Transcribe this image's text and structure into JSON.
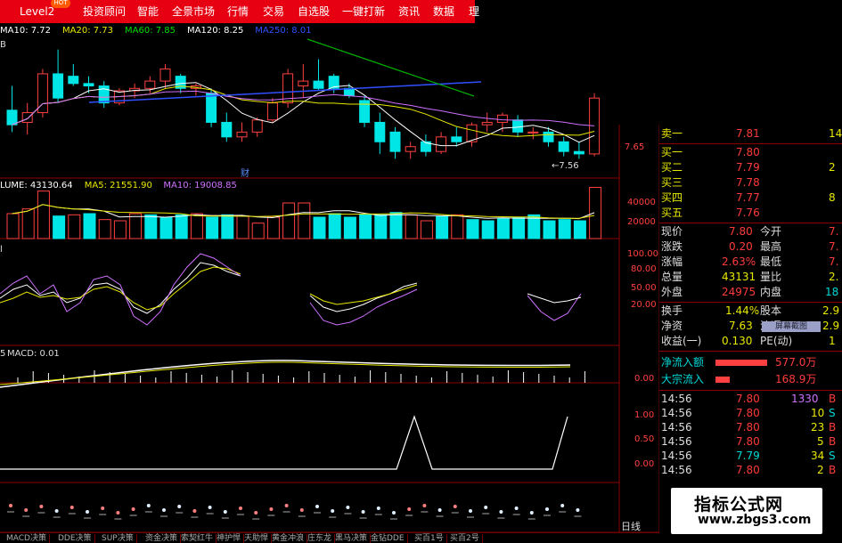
{
  "toolbar": {
    "items": [
      "Level2",
      "投资顾问",
      "智能",
      "全景市场",
      "行情",
      "交易",
      "自选股",
      "一键打新",
      "资讯",
      "数据",
      "理"
    ],
    "hot_badge": "HOT"
  },
  "main_chart": {
    "ma_legend": [
      {
        "text": "MA10: 7.72",
        "color": "#ffffff"
      },
      {
        "text": "MA20: 7.73",
        "color": "#e8e800"
      },
      {
        "text": "MA60: 7.85",
        "color": "#00dd00"
      },
      {
        "text": "MA120: 8.25",
        "color": "#ffffff"
      },
      {
        "text": "MA250: 8.01",
        "color": "#3050ff"
      }
    ],
    "left_fragment": "B",
    "y_label": "7.65",
    "low_marker": "←7.56",
    "cai_badge": "财",
    "candles": [
      {
        "o": 7.75,
        "h": 7.85,
        "l": 7.66,
        "c": 7.69
      },
      {
        "o": 7.7,
        "h": 7.78,
        "l": 7.65,
        "c": 7.74
      },
      {
        "o": 7.74,
        "h": 7.92,
        "l": 7.72,
        "c": 7.9
      },
      {
        "o": 7.9,
        "h": 8.0,
        "l": 7.78,
        "c": 7.8
      },
      {
        "o": 7.89,
        "h": 7.94,
        "l": 7.85,
        "c": 7.86
      },
      {
        "o": 7.86,
        "h": 7.89,
        "l": 7.82,
        "c": 7.85
      },
      {
        "o": 7.85,
        "h": 7.87,
        "l": 7.76,
        "c": 7.78
      },
      {
        "o": 7.78,
        "h": 7.84,
        "l": 7.77,
        "c": 7.83
      },
      {
        "o": 7.83,
        "h": 7.86,
        "l": 7.8,
        "c": 7.84
      },
      {
        "o": 7.84,
        "h": 7.89,
        "l": 7.82,
        "c": 7.87
      },
      {
        "o": 7.87,
        "h": 7.94,
        "l": 7.84,
        "c": 7.92
      },
      {
        "o": 7.89,
        "h": 7.9,
        "l": 7.82,
        "c": 7.84
      },
      {
        "o": 7.84,
        "h": 7.86,
        "l": 7.81,
        "c": 7.85
      },
      {
        "o": 7.82,
        "h": 7.84,
        "l": 7.68,
        "c": 7.7
      },
      {
        "o": 7.7,
        "h": 7.74,
        "l": 7.62,
        "c": 7.64
      },
      {
        "o": 7.64,
        "h": 7.7,
        "l": 7.62,
        "c": 7.66
      },
      {
        "o": 7.66,
        "h": 7.72,
        "l": 7.64,
        "c": 7.71
      },
      {
        "o": 7.71,
        "h": 7.8,
        "l": 7.7,
        "c": 7.78
      },
      {
        "o": 7.78,
        "h": 7.92,
        "l": 7.76,
        "c": 7.9
      },
      {
        "o": 7.85,
        "h": 7.94,
        "l": 7.8,
        "c": 7.87
      },
      {
        "o": 7.87,
        "h": 7.96,
        "l": 7.83,
        "c": 7.84
      },
      {
        "o": 7.89,
        "h": 7.9,
        "l": 7.82,
        "c": 7.84
      },
      {
        "o": 7.84,
        "h": 7.86,
        "l": 7.8,
        "c": 7.81
      },
      {
        "o": 7.79,
        "h": 7.81,
        "l": 7.68,
        "c": 7.7
      },
      {
        "o": 7.7,
        "h": 7.74,
        "l": 7.57,
        "c": 7.62
      },
      {
        "o": 7.66,
        "h": 7.68,
        "l": 7.55,
        "c": 7.58
      },
      {
        "o": 7.58,
        "h": 7.62,
        "l": 7.55,
        "c": 7.6
      },
      {
        "o": 7.62,
        "h": 7.65,
        "l": 7.56,
        "c": 7.58
      },
      {
        "o": 7.58,
        "h": 7.66,
        "l": 7.57,
        "c": 7.64
      },
      {
        "o": 7.64,
        "h": 7.68,
        "l": 7.6,
        "c": 7.62
      },
      {
        "o": 7.62,
        "h": 7.7,
        "l": 7.6,
        "c": 7.69
      },
      {
        "o": 7.69,
        "h": 7.74,
        "l": 7.66,
        "c": 7.7
      },
      {
        "o": 7.7,
        "h": 7.74,
        "l": 7.66,
        "c": 7.73
      },
      {
        "o": 7.71,
        "h": 7.73,
        "l": 7.64,
        "c": 7.66
      },
      {
        "o": 7.66,
        "h": 7.68,
        "l": 7.63,
        "c": 7.66
      },
      {
        "o": 7.66,
        "h": 7.68,
        "l": 7.6,
        "c": 7.62
      },
      {
        "o": 7.62,
        "h": 7.64,
        "l": 7.56,
        "c": 7.58
      },
      {
        "o": 7.58,
        "h": 7.62,
        "l": 7.55,
        "c": 7.57
      },
      {
        "o": 7.57,
        "h": 7.82,
        "l": 7.56,
        "c": 7.8
      }
    ]
  },
  "volume_chart": {
    "legend": [
      {
        "text": "LUME: 43130.64",
        "color": "#ffffff"
      },
      {
        "text": "MA5: 21551.90",
        "color": "#e8e800"
      },
      {
        "text": "MA10: 19008.85",
        "color": "#d070ff"
      }
    ],
    "y_labels": [
      "40000",
      "20000"
    ],
    "values": [
      21000,
      25000,
      40000,
      19000,
      20000,
      21000,
      16000,
      15000,
      21000,
      20000,
      18000,
      20000,
      21000,
      18000,
      20000,
      19000,
      13000,
      18000,
      30000,
      30000,
      18000,
      21000,
      18000,
      20000,
      20000,
      22000,
      20000,
      15000,
      19000,
      20000,
      16000,
      15000,
      17000,
      18000,
      20000,
      15000,
      16000,
      15000,
      43130
    ],
    "up_flags": [
      1,
      1,
      1,
      0,
      1,
      0,
      1,
      1,
      1,
      0,
      0,
      0,
      1,
      0,
      0,
      1,
      1,
      1,
      1,
      1,
      0,
      0,
      0,
      0,
      0,
      0,
      1,
      1,
      0,
      1,
      0,
      0,
      0,
      0,
      0,
      0,
      0,
      0,
      1
    ]
  },
  "kdj_chart": {
    "left_fragment": "l",
    "y_labels": [
      "100.00",
      "80.00",
      "50.00",
      "20.00"
    ]
  },
  "macd_chart": {
    "legend": "MACD: 0.01",
    "left_fragment": "5",
    "y_label": "0.00"
  },
  "signal_chart": {
    "y_labels": [
      "1.00",
      "0.50",
      "0.00"
    ]
  },
  "orderbook": {
    "rows": [
      {
        "label": "卖一",
        "price": "7.81",
        "vol": "14"
      },
      {
        "label": "买一",
        "price": "7.80",
        "vol": ""
      },
      {
        "label": "买二",
        "price": "7.79",
        "vol": "2"
      },
      {
        "label": "买三",
        "price": "7.78",
        "vol": ""
      },
      {
        "label": "买四",
        "price": "7.77",
        "vol": "8"
      },
      {
        "label": "买五",
        "price": "7.76",
        "vol": ""
      }
    ]
  },
  "quote": {
    "rows": [
      {
        "l1": "现价",
        "v1": "7.80",
        "l2": "今开",
        "v2": "7."
      },
      {
        "l1": "涨跌",
        "v1": "0.20",
        "l2": "最高",
        "v2": "7."
      },
      {
        "l1": "涨幅",
        "v1": "2.63%",
        "l2": "最低",
        "v2": "7."
      },
      {
        "l1": "总量",
        "v1": "43131",
        "l2": "量比",
        "v2": "2."
      },
      {
        "l1": "外盘",
        "v1": "24975",
        "l2": "内盘",
        "v2": "18"
      },
      {
        "l1": "换手",
        "v1": "1.44%",
        "l2": "股本",
        "v2": "2.9"
      },
      {
        "l1": "净资",
        "v1": "7.63",
        "l2": "流通",
        "v2": "2.9"
      },
      {
        "l1": "收益(一)",
        "v1": "0.130",
        "l2": "PE(动)",
        "v2": "1"
      }
    ],
    "screenshot_overlay": "屏幕截图"
  },
  "flows": [
    {
      "label": "净流入额",
      "value": "577.0万"
    },
    {
      "label": "大宗流入",
      "value": "168.9万"
    }
  ],
  "ticks": [
    {
      "time": "14:56",
      "price": "7.80",
      "vol": "1330",
      "dir": "B"
    },
    {
      "time": "14:56",
      "price": "7.80",
      "vol": "10",
      "dir": "S"
    },
    {
      "time": "14:56",
      "price": "7.80",
      "vol": "23",
      "dir": "B"
    },
    {
      "time": "14:56",
      "price": "7.80",
      "vol": "5",
      "dir": "B"
    },
    {
      "time": "14:56",
      "price": "7.79",
      "vol": "34",
      "dir": "S"
    },
    {
      "time": "14:56",
      "price": "7.80",
      "vol": "2",
      "dir": "B"
    }
  ],
  "bottom_tabs": [
    "MACD决策",
    "DDE决策",
    "SUP决策",
    "资金决策",
    "索契红牛",
    "神护悍",
    "天助悍",
    "黄金冲浪",
    "庄东龙",
    "黑马决策",
    "金钻DDE",
    "买百1号",
    "买百2号"
  ],
  "daily_button": "日线",
  "watermark": {
    "line1": "指标公式网",
    "line2": "www.zbgs3.com"
  },
  "colors": {
    "toolbar": "#e60012",
    "up": "#ff4040",
    "down": "#00e5e5",
    "grid": "#8a0000"
  }
}
